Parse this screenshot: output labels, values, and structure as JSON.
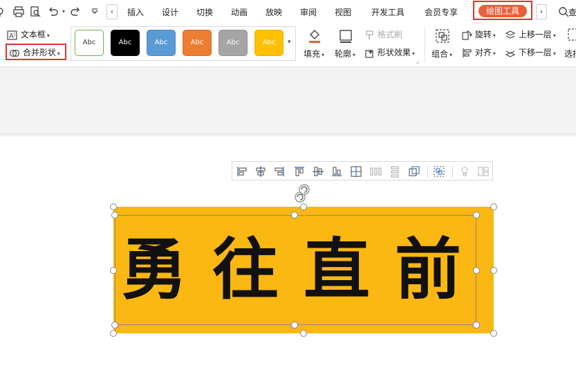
{
  "tabs": [
    "插入",
    "设计",
    "切换",
    "动画",
    "放映",
    "审阅",
    "视图",
    "开发工具",
    "会员专享"
  ],
  "active_tab": "绘图工具",
  "search_hint": "查",
  "ribbon": {
    "textbox": "文本框",
    "merge_shapes": "合并形状",
    "style_label": "Abc",
    "fill": "填充",
    "outline": "轮廓",
    "format_painter": "格式刷",
    "shape_effects": "形状效果",
    "group": "组合",
    "rotate": "旋转",
    "align": "对齐",
    "bring_forward": "上移一层",
    "send_backward": "下移一层",
    "select": "选择"
  },
  "styles": [
    {
      "bg": "#ffffff",
      "border": "#6cb33f",
      "fg": "#333333"
    },
    {
      "bg": "#000000",
      "border": "#000000",
      "fg": "#ffffff"
    },
    {
      "bg": "#5b9bd5",
      "border": "#4a89c2",
      "fg": "#ffffff"
    },
    {
      "bg": "#ed7d31",
      "border": "#d96b22",
      "fg": "#ffffff"
    },
    {
      "bg": "#a5a5a5",
      "border": "#929292",
      "fg": "#ffffff"
    },
    {
      "bg": "#ffc000",
      "border": "#e6ad00",
      "fg": "#ffffff"
    }
  ],
  "canvas": {
    "shape_text": "勇往直前",
    "shape_color": "#fbb712"
  }
}
